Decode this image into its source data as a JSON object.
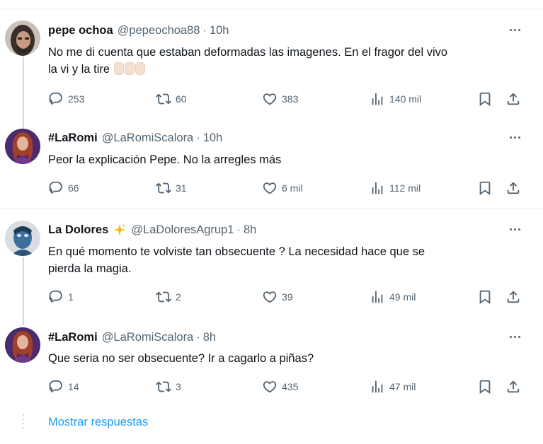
{
  "tweets": [
    {
      "name": "pepe ochoa",
      "handle": "@pepeochoa88",
      "separator": "·",
      "time": "10h",
      "text_lines": [
        "No me di cuenta que estaban deformadas las imagenes. En el fragor del vivo",
        "la vi y la tire"
      ],
      "reply": "253",
      "retweet": "60",
      "like": "383",
      "views": "140 mil",
      "avatar": "man-with-long-hair-avatar"
    },
    {
      "name": "#LaRomi",
      "handle": "@LaRomiScalora",
      "separator": "·",
      "time": "10h",
      "text_lines": [
        "Peor la explicación Pepe. No la arregles más"
      ],
      "reply": "66",
      "retweet": "31",
      "like": "6 mil",
      "views": "112 mil",
      "avatar": "woman-red-hair-avatar"
    },
    {
      "name": "La Dolores",
      "handle": "@LaDoloresAgrup1",
      "separator": "·",
      "time": "8h",
      "text_lines": [
        "En qué momento te volviste tan obsecuente ? La necesidad hace que se",
        "pierda la magia."
      ],
      "reply": "1",
      "retweet": "2",
      "like": "39",
      "views": "49 mil",
      "avatar": "blue-character-avatar"
    },
    {
      "name": "#LaRomi",
      "handle": "@LaRomiScalora",
      "separator": "·",
      "time": "8h",
      "text_lines": [
        "Que seria no ser obsecuente? Ir a cagarlo a piñas?"
      ],
      "reply": "14",
      "retweet": "3",
      "like": "435",
      "views": "47 mil",
      "avatar": "woman-red-hair-avatar"
    }
  ],
  "show_replies_label": "Mostrar respuestas",
  "colors": {
    "text": "#0f1419",
    "muted": "#536471",
    "link": "#1d9bf0",
    "divider": "#eff3f4",
    "thread": "#cfd9de"
  },
  "icons": [
    "reply-icon",
    "retweet-icon",
    "like-icon",
    "views-icon",
    "bookmark-icon",
    "share-icon",
    "more-icon",
    "sparkle-icon",
    "hands-emoji"
  ]
}
